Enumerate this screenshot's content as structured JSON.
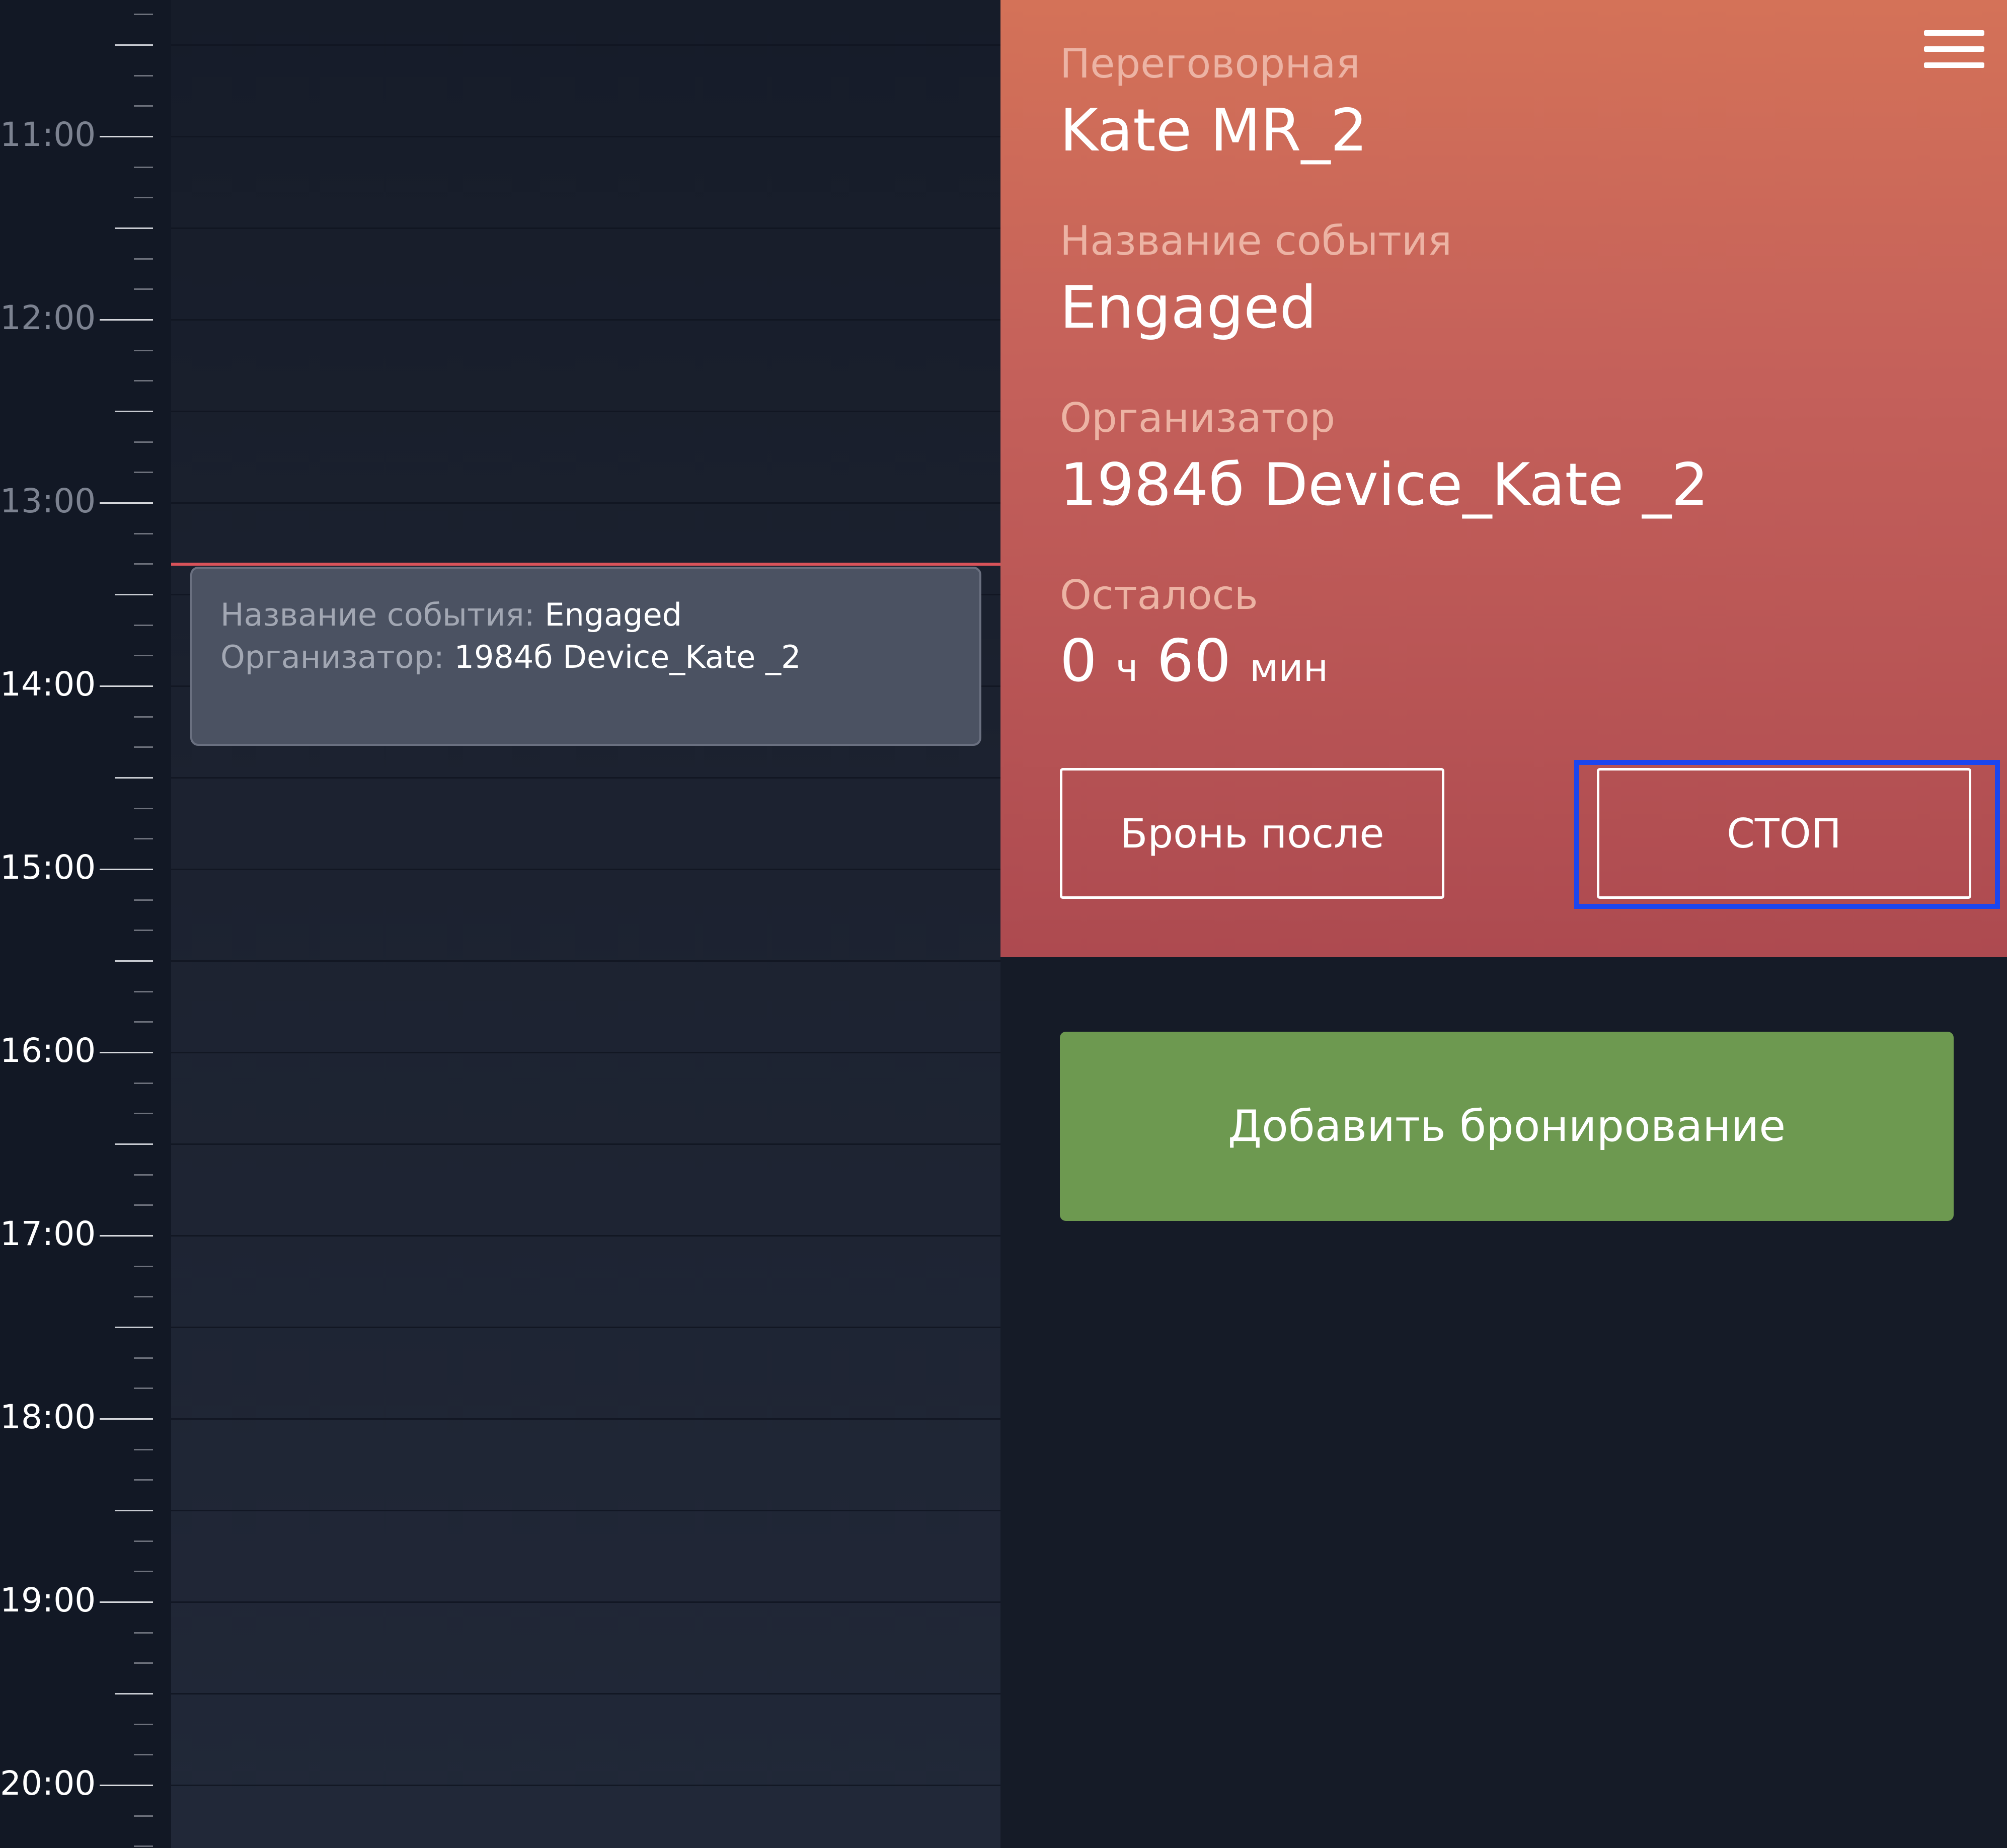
{
  "schedule": {
    "hours": [
      "11:00",
      "12:00",
      "13:00",
      "14:00",
      "15:00",
      "16:00",
      "17:00",
      "18:00",
      "19:00",
      "20:00"
    ],
    "event": {
      "name_label": "Название события:",
      "name_value": "Engaged",
      "organizer_label": "Организатор:",
      "organizer_value": "1984б Device_Kate _2"
    }
  },
  "details": {
    "room_label": "Переговорная",
    "room_value": "Kate MR_2",
    "event_label": "Название события",
    "event_value": "Engaged",
    "organizer_label": "Организатор",
    "organizer_value": "1984б Device_Kate _2",
    "remaining_label": "Осталось",
    "remaining_hours": "0",
    "remaining_hours_unit": "ч",
    "remaining_minutes": "60",
    "remaining_minutes_unit": "мин"
  },
  "actions": {
    "book_after_label": "Бронь после",
    "stop_label": "СТОП",
    "add_booking_label": "Добавить бронирование"
  },
  "colors": {
    "details_gradient_top": "#d47258",
    "details_gradient_bottom": "#ad4a50",
    "current_time_line": "#d9535a",
    "add_booking_button": "#6d9950",
    "selection_highlight": "#1a46f0",
    "background": "#151b27"
  },
  "icons": {
    "menu": "hamburger-menu-icon"
  }
}
